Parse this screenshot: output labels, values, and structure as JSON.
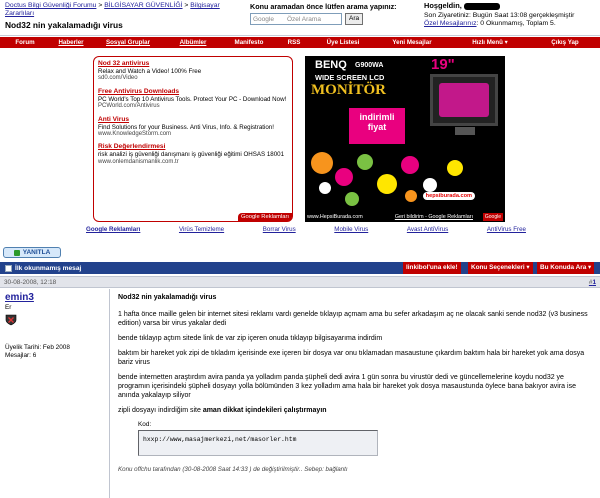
{
  "breadcrumb": {
    "forum": "Doctus Bilgi Güvenliği Forumu",
    "sep1": ">",
    "section": "BİLGİSAYAR GÜVENLİĞİ",
    "sep2": ">",
    "subsection": "Bilgisayar Zararlıları"
  },
  "thread_title": "Nod32 nin yakalamadığı virus",
  "search": {
    "label": "Konu aramadan önce lütfen arama yapınız:",
    "placeholder": "Özel Arama",
    "google": "Google",
    "button": "Ara"
  },
  "welcome": {
    "greeting": "Hoşgeldin,",
    "last_visit": "Son Ziyaretiniz: Bugün Saat 13:08 gerçekleşmiştir",
    "pm_link": "Özel Mesajlarınız",
    "pm_counts": ": 0 Okunmamış, Toplam 5."
  },
  "nav": [
    "Forum",
    "Haberler",
    "Sosyal Gruplar",
    "Albümler",
    "Manifesto",
    "RSS",
    "Üye Listesi",
    "Yeni Mesajlar",
    "Hızlı Menü ▾",
    "Çıkış Yap"
  ],
  "ads": [
    {
      "title": "Nod 32 antivirus",
      "desc": "Relax and Watch a Video! 100% Free",
      "url": "sd0.com/Video"
    },
    {
      "title": "Free Antivirus Downloads",
      "desc": "PC World's Top 10 Antivirus Tools. Protect Your PC - Download Now!",
      "url": "PCWorld.com/Antivirus"
    },
    {
      "title": "Anti Virus",
      "desc": "Find Solutions for your Business. Anti Virus, Info. & Registration!",
      "url": "www.KnowledgeStorm.com"
    },
    {
      "title": "Risk Değerlendirmesi",
      "desc": "risk analizi iş güvenliği danışmanı iş güvenliği eğitimi OHSAS 18001",
      "url": "www.onlemdanismanlik.com.tr"
    }
  ],
  "google_ads_tag": "Google Reklamları",
  "banner": {
    "brand": "BENQ",
    "model": "G900WA",
    "size": "19\"",
    "wide": "WIDE SCREEN LCD",
    "headline": "MONİTÖR",
    "deal_line1": "indirimli",
    "deal_line2": "fiyat",
    "site_url": "www.HepsiBurada.com",
    "logo": "hepsiburada.com",
    "ad_link": "Geri bildirim - Google Reklamları",
    "google_tag": "Google"
  },
  "ad_links": [
    "Google Reklamları",
    "Virüs Temizleme",
    "Borrar Virus",
    "Mobile Virus",
    "Avast AntiVirus",
    "AntiVirus Free"
  ],
  "reply_button": "YANITLA",
  "tools": {
    "first_unread": "İlk okunmamış mesaj",
    "link_ekle": "linkibol'una ekle!",
    "thread_options": "Konu Seçenekleri ▾",
    "search_thread": "Bu Konuda Ara ▾"
  },
  "post": {
    "date": "30-08-2008, 12:18",
    "number_prefix": "#",
    "number": "1",
    "username": "emin3",
    "rank": "Er",
    "join_date": "Üyelik Tarihi: Feb 2008",
    "messages": "Mesajlar: 6",
    "title": "Nod32 nin yakalamadığı virus",
    "paragraphs": [
      "1 hafta önce maille gelen bir internet sitesi reklamı vardı genelde tıklayıp açmam ama bu sefer arkadaşım aç ne olacak sanki sende nod32 (v3 business edition) varsa bir virus yakalar dedi",
      "bende tıklayıp açtım sitede link de var zip içeren onuda tıklayıp bilgisayarıma indirdim",
      "baktım bir hareket yok zipi de tıkladım içerisinde exe içeren bir dosya var onu tıklamadan masaustune çıkardım baktım hala bir hareket yok ama dosya bariz virus",
      "bende internetten araştırdım avira panda ya yolladım panda şüpheli dedi avira 1 gün sonra bu virustür dedi ve güncellemelerine koydu nod32 ye programın içerisindeki şüpheli dosyayı yolla bölümünden 3 kez yolladım ama hala bir hareket yok dosya masaustunda öylece bana bakıyor avira ise anında yakalayıp siliyor"
    ],
    "zip_line_plain": "zipli dosyayı indirdiğim site ",
    "zip_line_bold": "aman dikkat içindekileri çalıştırmayın",
    "code_label": "Kod:",
    "code": "hxxp://www,masajmerkezi,net/masorler.htm",
    "edit_note": "Konu offchu tarafından (30-08-2008 Saat 14:33 ) de değiştirilmiştir.. Sebep: bağlantı"
  },
  "colors": {
    "nav_red": "#c00000",
    "tools_blue": "#22428c",
    "link": "#22229c"
  }
}
